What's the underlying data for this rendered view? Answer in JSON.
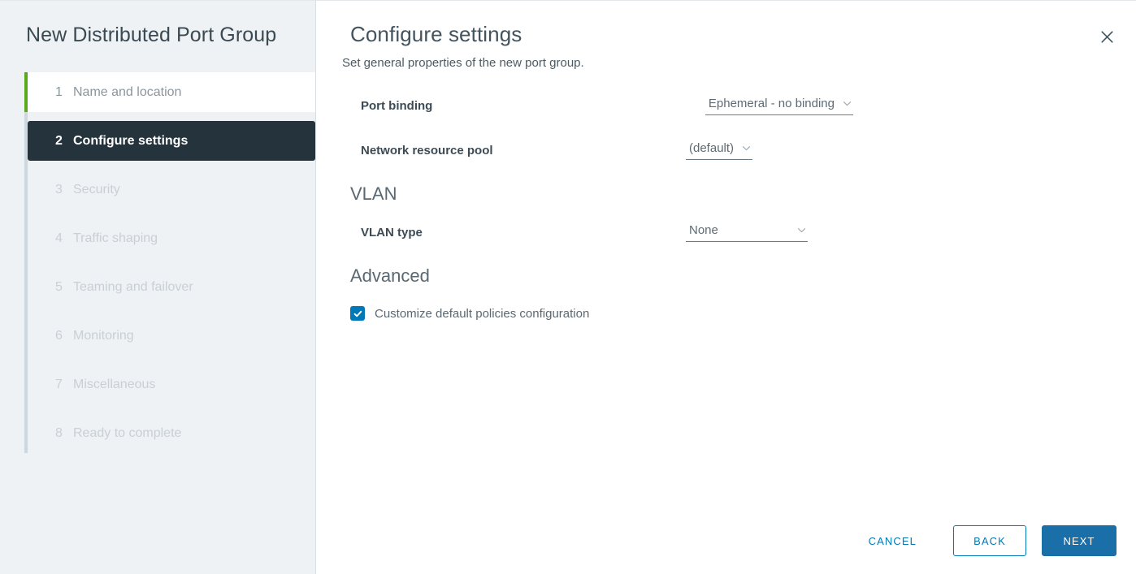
{
  "wizard": {
    "title": "New Distributed Port Group",
    "steps": [
      {
        "num": "1",
        "label": "Name and location",
        "state": "completed"
      },
      {
        "num": "2",
        "label": "Configure settings",
        "state": "active"
      },
      {
        "num": "3",
        "label": "Security",
        "state": "pending"
      },
      {
        "num": "4",
        "label": "Traffic shaping",
        "state": "pending"
      },
      {
        "num": "5",
        "label": "Teaming and failover",
        "state": "pending"
      },
      {
        "num": "6",
        "label": "Monitoring",
        "state": "pending"
      },
      {
        "num": "7",
        "label": "Miscellaneous",
        "state": "pending"
      },
      {
        "num": "8",
        "label": "Ready to complete",
        "state": "pending"
      }
    ]
  },
  "page": {
    "title": "Configure settings",
    "subtitle": "Set general properties of the new port group.",
    "close_icon": "close-icon"
  },
  "form": {
    "port_binding": {
      "label": "Port binding",
      "value": "Ephemeral - no binding",
      "caret_icon": "chevron-down-icon"
    },
    "network_resource_pool": {
      "label": "Network resource pool",
      "value": "(default)",
      "caret_icon": "chevron-down-icon"
    },
    "vlan_section": "VLAN",
    "vlan_type": {
      "label": "VLAN type",
      "value": "None",
      "caret_icon": "chevron-down-icon"
    },
    "advanced_section": "Advanced",
    "customize_policies": {
      "label": "Customize default policies configuration",
      "checked": true,
      "check_icon": "check-icon"
    }
  },
  "footer": {
    "cancel_label": "Cancel",
    "back_label": "Back",
    "next_label": "Next"
  },
  "colors": {
    "accent_green": "#5aa81b",
    "active_step_bg": "#25333d",
    "primary_blue": "#1a6fa8",
    "link_blue": "#0079b8",
    "checkbox_blue": "#0079b8",
    "sidebar_bg": "#eef2f5"
  }
}
